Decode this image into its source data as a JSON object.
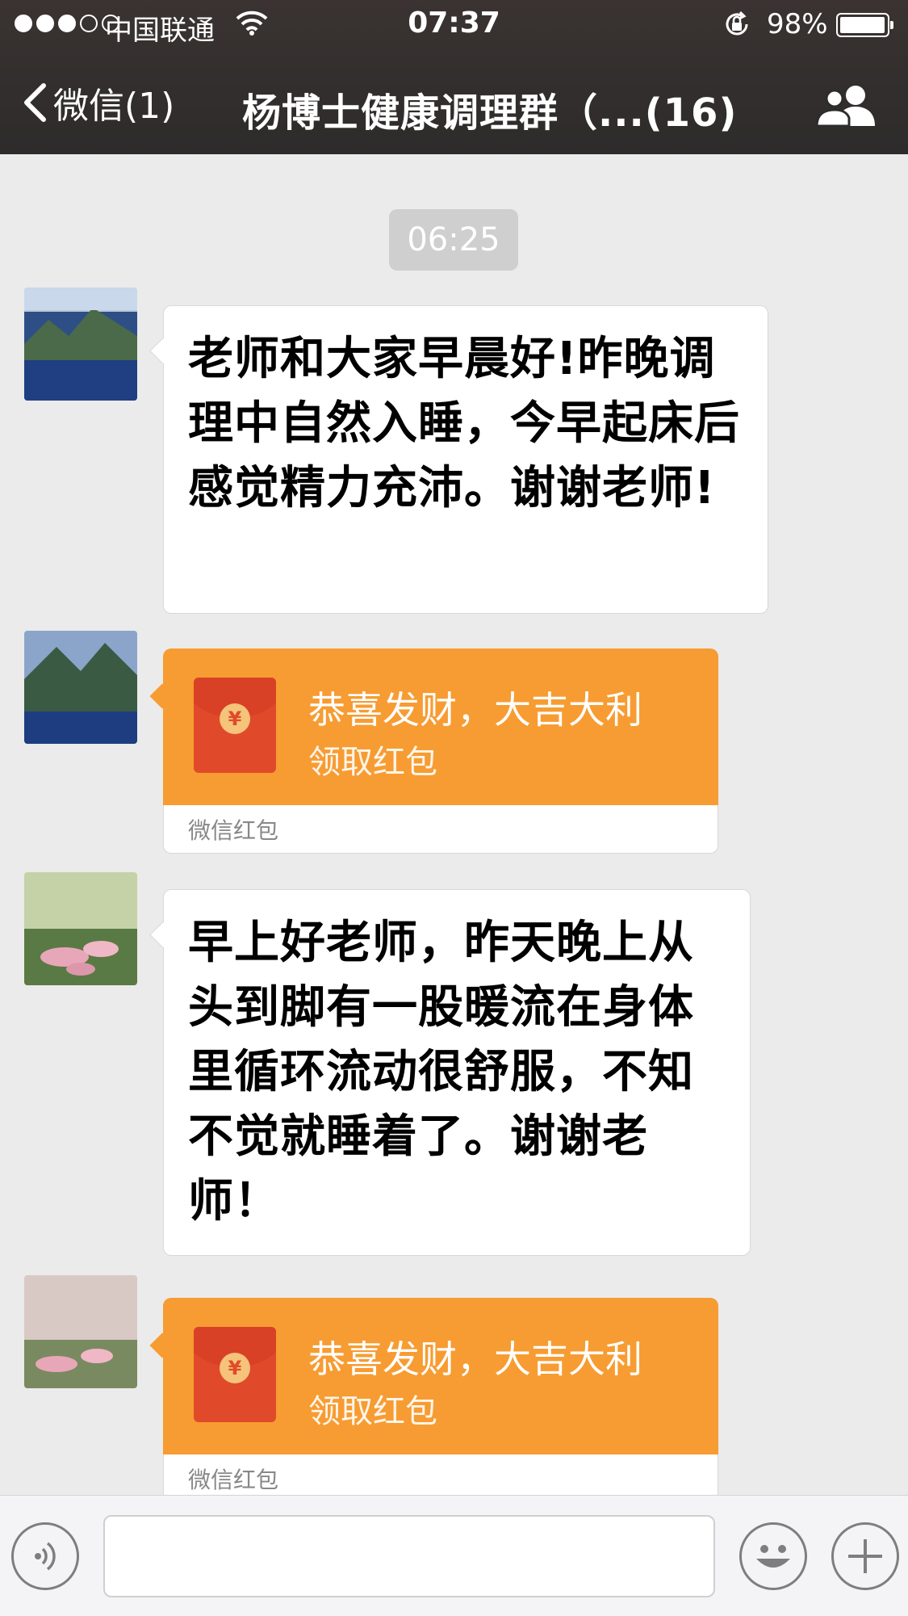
{
  "status_bar": {
    "carrier": "中国联通",
    "time": "07:37",
    "battery_percent": "98%",
    "battery_level": 0.98,
    "signal_bars": 3
  },
  "nav": {
    "back_label": "微信(1)",
    "title": "杨博士健康调理群（...(16)"
  },
  "messages": {
    "timestamp": "06:25",
    "m1": {
      "text": "老师和大家早晨好!昨晚调理中自然入睡，今早起床后感觉精力充沛。谢谢老师!"
    },
    "m2": {
      "greeting": "恭喜发财，大吉大利",
      "action": "领取红包",
      "brand": "微信红包"
    },
    "m3": {
      "text": "早上好老师，昨天晚上从头到脚有一股暖流在身体里循环流动很舒服，不知不觉就睡着了。谢谢老师！"
    },
    "m4": {
      "greeting": "恭喜发财，大吉大利",
      "action": "领取红包",
      "brand": "微信红包"
    }
  },
  "input_bar": {
    "voice_icon": "voice-icon",
    "emoji_icon": "emoji-icon",
    "plus_icon": "plus-icon",
    "text_value": ""
  },
  "colors": {
    "nav_bg": "#2d2b2b",
    "chat_bg": "#ebebeb",
    "red_packet": "#f79c32",
    "envelope": "#e04a2a"
  }
}
